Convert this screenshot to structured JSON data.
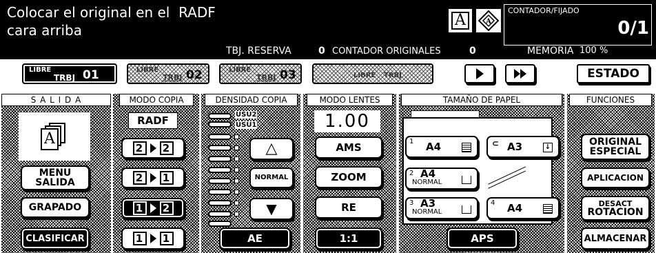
{
  "header": {
    "message_line1": "Colocar el original en el  RADF",
    "message_line2": "cara arriba",
    "counter_label": "CONTADOR/FIJADO",
    "counter_value": "0/1",
    "status_reserve": "TBJ. RESERVA",
    "status_reserve_value": "0",
    "status_originals": "CONTADOR ORIGINALES",
    "status_originals_value": "0",
    "status_memory": "MEMORIA",
    "status_memory_value": "100 %"
  },
  "jobs": [
    {
      "label": "LIBRE",
      "trbj": "TRBJ",
      "num": "01"
    },
    {
      "label": "LIBRE",
      "trbj": "TRBJ",
      "num": "02"
    },
    {
      "label": "LIBRE",
      "trbj": "TRBJ",
      "num": "03"
    },
    {
      "label": "LIBRE",
      "trbj": "TRBJ",
      "num": ""
    }
  ],
  "estado_label": "ESTADO",
  "sections": {
    "salida": "S A L I D A",
    "modo_copia": "MODO COPIA",
    "densidad": "DENSIDAD COPIA",
    "lentes": "MODO LENTES",
    "papel": "TAMAÑO DE PAPEL",
    "funciones": "FUNCIONES"
  },
  "salida": {
    "menu_line1": "MENU",
    "menu_line2": "SALIDA",
    "grapado": "GRAPADO",
    "clasificar": "CLASIFICAR"
  },
  "modo_copia": {
    "radf": "RADF",
    "modes": [
      {
        "from": "2",
        "to": "2"
      },
      {
        "from": "2",
        "to": "1"
      },
      {
        "from": "1",
        "to": "2"
      },
      {
        "from": "1",
        "to": "1"
      }
    ]
  },
  "densidad": {
    "usu2": "USU2",
    "usu1": "USU1",
    "lighter": "△",
    "normal": "NORMAL",
    "darker": "▼",
    "ae": "AE"
  },
  "lentes": {
    "zoom_value": "1.00",
    "ams": "AMS",
    "zoom": "ZOOM",
    "re": "RE",
    "one_to_one": "1:1"
  },
  "papel": {
    "trays": [
      {
        "num": "1",
        "size": "A4",
        "sub": ""
      },
      {
        "num": "2",
        "size": "A4",
        "sub": "NORMAL"
      },
      {
        "num": "3",
        "size": "A3",
        "sub": "NORMAL"
      },
      {
        "num": "4",
        "size": "A4",
        "sub": ""
      }
    ],
    "bypass_size": "A3",
    "aps": "APS"
  },
  "funciones": {
    "original_line1": "ORIGINAL",
    "original_line2": "ESPECIAL",
    "aplicacion": "APLICACION",
    "desact_line1": "DESACT",
    "desact_line2": "ROTACION",
    "almacenar": "ALMACENAR"
  }
}
